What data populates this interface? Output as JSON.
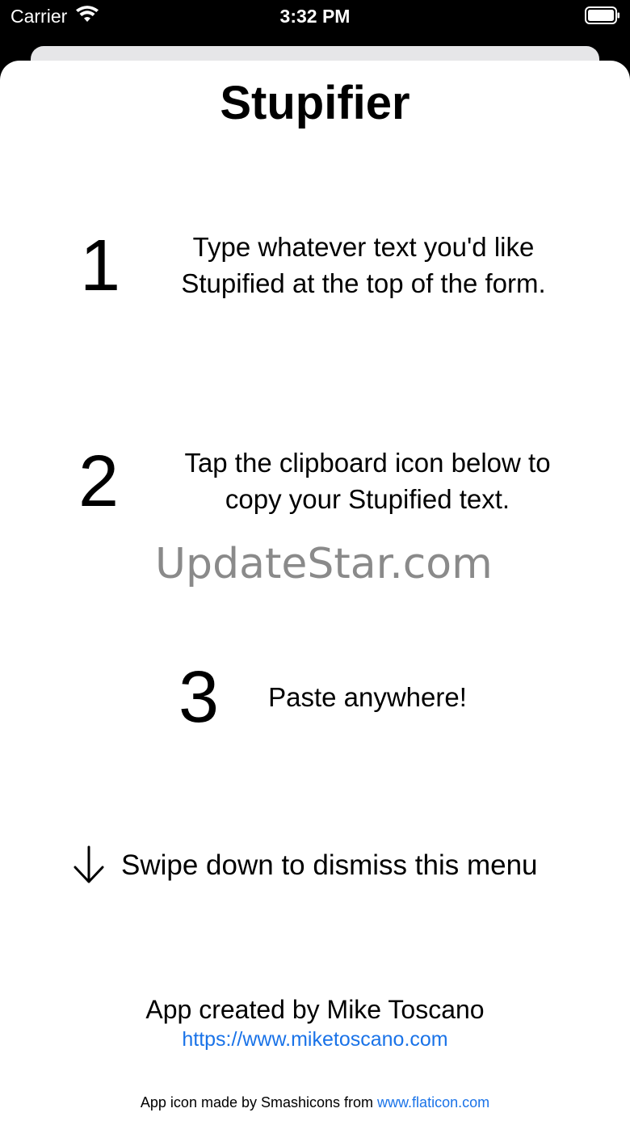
{
  "status_bar": {
    "carrier": "Carrier",
    "time": "3:32 PM"
  },
  "sheet": {
    "title": "Stupifier",
    "steps": [
      {
        "number": "1",
        "text": "Type whatever text you'd like\nStupified at the top of the form."
      },
      {
        "number": "2",
        "text": "Tap the clipboard icon below to\ncopy your Stupified text."
      },
      {
        "number": "3",
        "text": "Paste anywhere!"
      }
    ],
    "watermark": "UpdateStar.com",
    "swipe_hint": "Swipe down to dismiss this menu",
    "credit": "App created by Mike Toscano",
    "credit_link": "https://www.miketoscano.com",
    "footer_prefix": "App icon made by Smashicons from ",
    "footer_link": "www.flaticon.com"
  },
  "colors": {
    "link": "#1a73e8",
    "watermark": "#8a8a8a",
    "background": "#000000",
    "sheet": "#ffffff"
  },
  "icons": {
    "wifi": "wifi-icon",
    "battery": "battery-icon",
    "arrow": "arrow-down-icon"
  }
}
